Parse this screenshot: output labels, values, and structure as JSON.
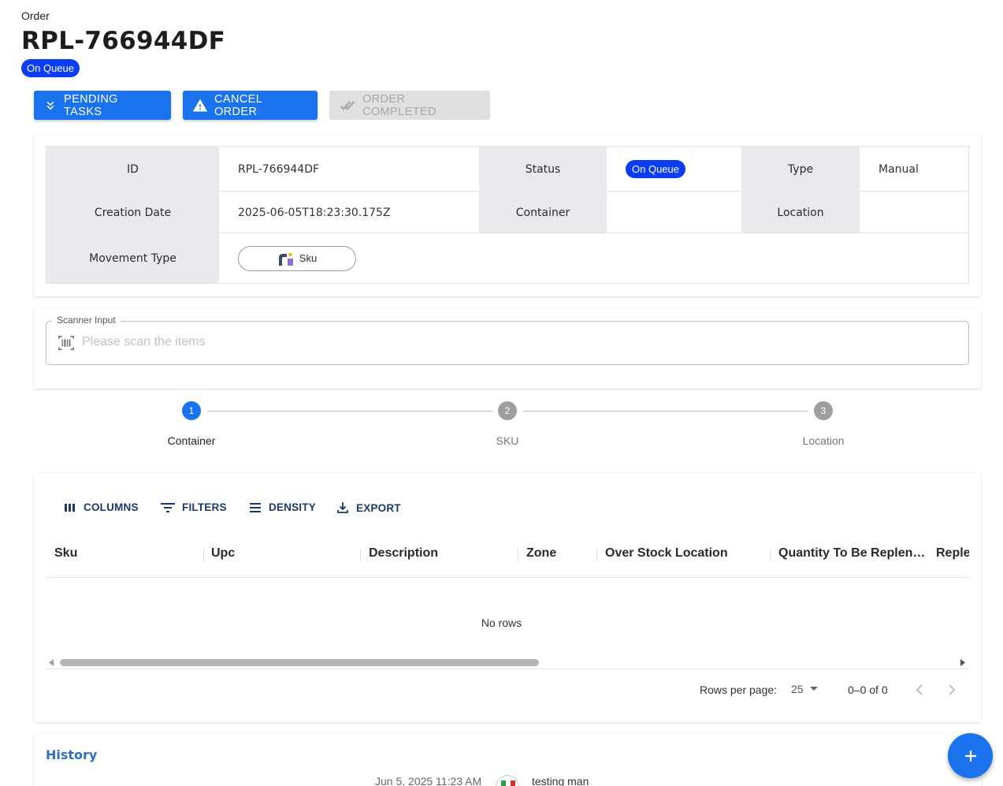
{
  "header": {
    "section_label": "Order",
    "order_id": "RPL-766944DF",
    "status": "On Queue"
  },
  "actions": {
    "pending_tasks": "PENDING TASKS",
    "cancel_order": "CANCEL ORDER",
    "order_completed": "ORDER COMPLETED"
  },
  "details": {
    "id_label": "ID",
    "id_value": "RPL-766944DF",
    "status_label": "Status",
    "status_value": "On Queue",
    "type_label": "Type",
    "type_value": "Manual",
    "creation_date_label": "Creation Date",
    "creation_date_value": "2025-06-05T18:23:30.175Z",
    "container_label": "Container",
    "container_value": "",
    "location_label": "Location",
    "location_value": "",
    "movement_type_label": "Movement Type",
    "movement_type_value": "Sku"
  },
  "scanner": {
    "label": "Scanner Input",
    "placeholder": "Please scan the items"
  },
  "stepper": {
    "steps": [
      {
        "number": "1",
        "label": "Container",
        "active": true
      },
      {
        "number": "2",
        "label": "SKU",
        "active": false
      },
      {
        "number": "3",
        "label": "Location",
        "active": false
      }
    ]
  },
  "grid": {
    "toolbar": {
      "columns": "COLUMNS",
      "filters": "FILTERS",
      "density": "DENSITY",
      "export": "EXPORT"
    },
    "columns": [
      "Sku",
      "Upc",
      "Description",
      "Zone",
      "Over Stock Location",
      "Quantity To Be Replen…",
      "Reple"
    ],
    "empty_text": "No rows",
    "rows_per_page_label": "Rows per page:",
    "rows_per_page_value": "25",
    "pagination_text": "0–0 of 0"
  },
  "history": {
    "title": "History",
    "entries": [
      {
        "date": "Jun 5, 2025 11:23 AM",
        "user": "testing man"
      }
    ]
  },
  "colors": {
    "primary": "#1a72ec",
    "status_chip": "#0a3df5",
    "label_bg": "#e8eaee",
    "history_title": "#2f6ec0"
  },
  "icons": {
    "pending_tasks": "double-chevron-down-icon",
    "cancel_order": "warning-icon",
    "order_completed": "double-check-icon",
    "movement_type": "person-box-icon",
    "scanner": "barcode-icon",
    "columns": "columns-icon",
    "filters": "filter-icon",
    "density": "density-icon",
    "export": "export-icon",
    "fab": "plus-icon"
  }
}
